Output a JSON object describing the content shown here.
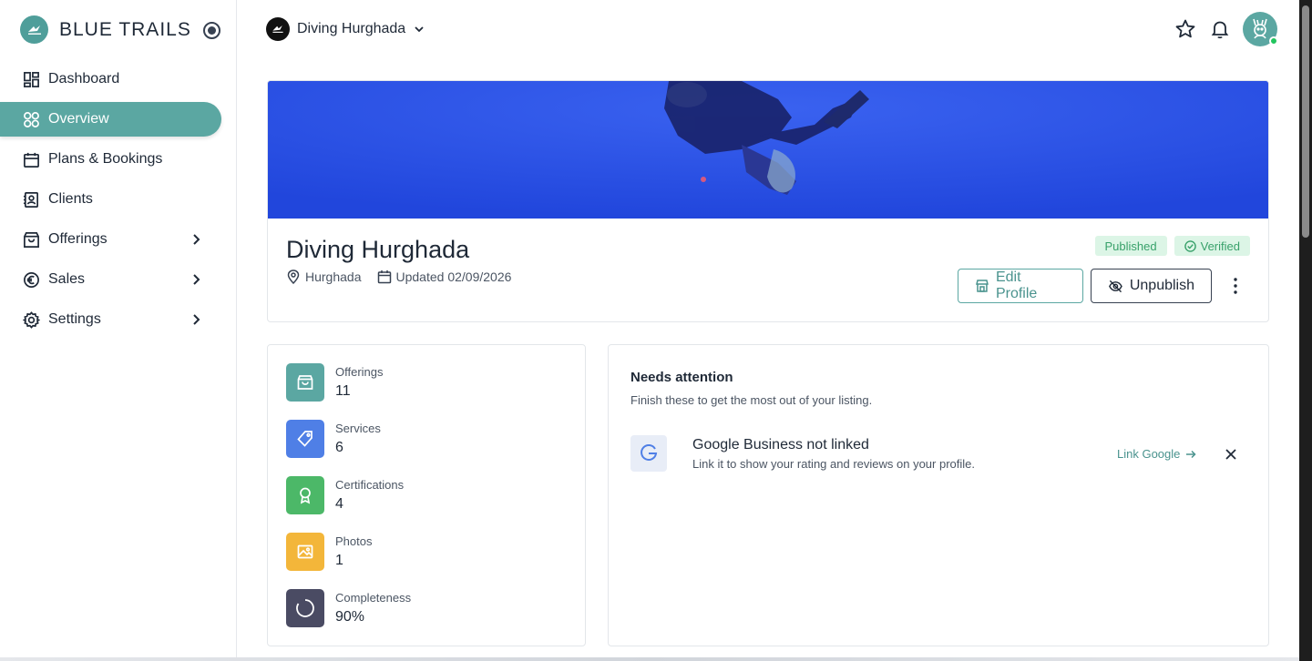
{
  "brand": {
    "name": "BLUE TRAILS",
    "logo_text": "BLUE TRAILS"
  },
  "nav": {
    "items": [
      {
        "label": "Dashboard",
        "icon": "dashboard-icon",
        "active": false
      },
      {
        "label": "Overview",
        "icon": "overview-icon",
        "active": true
      },
      {
        "label": "Plans & Bookings",
        "icon": "calendar-icon",
        "active": false
      },
      {
        "label": "Clients",
        "icon": "contacts-icon",
        "active": false
      },
      {
        "label": "Offerings",
        "icon": "bag-icon",
        "active": false,
        "has_children": true
      },
      {
        "label": "Sales",
        "icon": "euro-icon",
        "active": false,
        "has_children": true
      },
      {
        "label": "Settings",
        "icon": "gear-icon",
        "active": false,
        "has_children": true
      }
    ]
  },
  "topbar": {
    "org_name": "Diving Hurghada"
  },
  "profile": {
    "title": "Diving Hurghada",
    "location": "Hurghada",
    "updated": "Updated 02/09/2026",
    "badges": {
      "published": "Published",
      "verified": "Verified"
    },
    "actions": {
      "edit": "Edit Profile",
      "unpublish": "Unpublish"
    }
  },
  "stats": [
    {
      "label": "Offerings",
      "value": "11",
      "color": "#5ba7a2",
      "icon": "bag-icon"
    },
    {
      "label": "Services",
      "value": "6",
      "color": "#4f7fe6",
      "icon": "tag-icon"
    },
    {
      "label": "Certifications",
      "value": "4",
      "color": "#4cb868",
      "icon": "award-icon"
    },
    {
      "label": "Photos",
      "value": "1",
      "color": "#f3b63a",
      "icon": "image-icon"
    },
    {
      "label": "Completeness",
      "value": "90%",
      "color": "#4a4b63",
      "icon": "progress-ring-icon"
    }
  ],
  "attention": {
    "title": "Needs attention",
    "subtitle": "Finish these to get the most out of your listing.",
    "task": {
      "title": "Google Business not linked",
      "description": "Link it to show your rating and reviews on your profile.",
      "link": "Link Google"
    }
  },
  "colors": {
    "accent": "#5ba7a2",
    "hero_blue": "#2448e0",
    "badge_green": "#38a16a"
  }
}
